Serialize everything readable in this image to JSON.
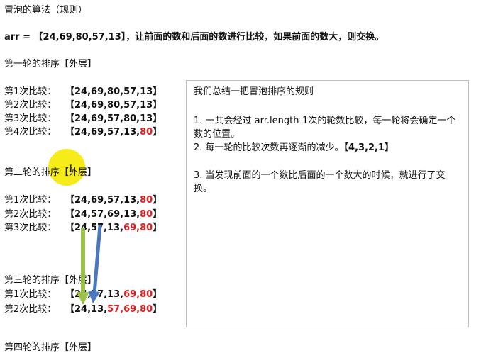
{
  "title": "冒泡的算法（规则）",
  "intro": {
    "prefix": "arr = ",
    "array": "【24,69,80,57,13】",
    "text": "，让前面的数和后面的数进行比较，如果前面的数大，则交换。"
  },
  "rounds": [
    {
      "heading": "第一轮的排序【外层】",
      "comparisons": [
        {
          "label": "第1次比较：",
          "normal": "【24,69,80,57,13】",
          "red": "",
          "tail": ""
        },
        {
          "label": "第2次比较：",
          "normal": "【24,69,80,57,13】",
          "red": "",
          "tail": ""
        },
        {
          "label": "第3次比较：",
          "normal": "【24,69,57,80,13】",
          "red": "",
          "tail": ""
        },
        {
          "label": "第4次比较：",
          "normal": "【24,69,57,13,",
          "red": "80",
          "tail": "】"
        }
      ]
    },
    {
      "heading": "第二轮的排序【外层】",
      "comparisons": [
        {
          "label": "第1次比较：",
          "normal": "【24,69,57,13,",
          "red": "80",
          "tail": "】"
        },
        {
          "label": "第2次比较：",
          "normal": "【24,57,69,13,",
          "red": "80",
          "tail": "】"
        },
        {
          "label": "第3次比较：",
          "normal": "【24,57,13,",
          "red": "69,80",
          "tail": "】"
        }
      ]
    },
    {
      "heading": "第三轮的排序【外层】",
      "comparisons": [
        {
          "label": "第1次比较：",
          "normal": "【24,57,13,",
          "red": "69,80",
          "tail": "】"
        },
        {
          "label": "第2次比较：",
          "normal": "【24,13,",
          "red": "57,69,80",
          "tail": "】"
        }
      ]
    },
    {
      "heading": "第四轮的排序【外层】",
      "comparisons": []
    }
  ],
  "summary": {
    "title": "我们总结一把冒泡排序的规则",
    "rule1": "1. 一共会经过 arr.length-1次的轮数比较，每一轮将会确定一个数的位置。",
    "rule2_text": "2. 每一轮的比较次数再逐渐的减少。",
    "rule2_values": "【4,3,2,1】",
    "rule3": "3. 当发现前面的一个数比后面的一个数大的时候，就进行了交换。"
  },
  "arrow_colors": {
    "green": "#9bc14a",
    "blue": "#4a78c0"
  }
}
